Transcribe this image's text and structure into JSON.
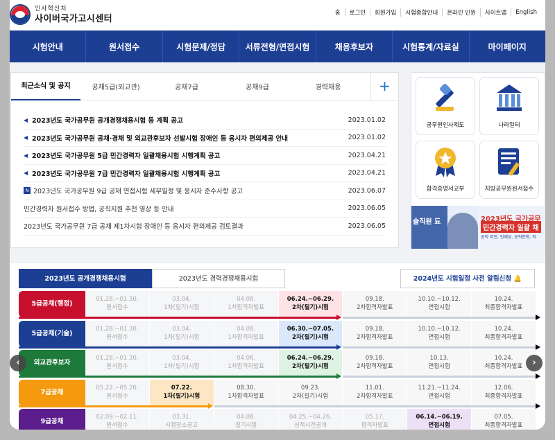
{
  "header": {
    "logo_small": "인사혁신처",
    "logo_big": "사이버국가고시센터",
    "util": [
      "홈",
      "로그인",
      "회원가입",
      "시험종합안내",
      "온라인 민원",
      "사이트맵",
      "English"
    ]
  },
  "nav": [
    "시험안내",
    "원서접수",
    "시험문제/정답",
    "서류전형/면접시험",
    "채용후보자",
    "시험통계/자료실",
    "마이페이지"
  ],
  "news": {
    "tabs": [
      "최근소식 및 공지",
      "공채5급(외교관)",
      "공채7급",
      "공채9급",
      "경력채용"
    ],
    "plus": "+",
    "items": [
      {
        "title": "2023년도 국가공무원 공개경쟁채용시험 등 계획 공고",
        "date": "2023.01.02",
        "bold": true,
        "icon": "speaker"
      },
      {
        "title": "2023년도 국가공무원 공채·경채 및 외교관후보자 선발시험 장애인 등 응시자 편의제공 안내",
        "date": "2023.01.02",
        "bold": true,
        "icon": "speaker"
      },
      {
        "title": "2023년도 국가공무원 5급 민간경력자 일괄채용시험 시행계획 공고",
        "date": "2023.04.21",
        "bold": true,
        "icon": "speaker"
      },
      {
        "title": "2023년도 국가공무원 7급 민간경력자 일괄채용시험 시행계획 공고",
        "date": "2023.04.21",
        "bold": true,
        "icon": "speaker"
      },
      {
        "title": "2023년도 국가공무원 9급 공채 면접시험 세부일정 및 응시자 준수사항 공고",
        "date": "2023.06.07",
        "bold": false,
        "icon": "new"
      },
      {
        "title": "민간경력자 원서접수 방법, 공직지원 추천 영상 등 안내",
        "date": "2023.06.05",
        "bold": false,
        "icon": ""
      },
      {
        "title": "2023년도 국가공무원 7급 공채 제1차시험 장애인 등 응시자 편의제공 검토결과",
        "date": "2023.06.05",
        "bold": false,
        "icon": ""
      }
    ]
  },
  "quick": {
    "cards": [
      "공무원인사제도",
      "나라일터",
      "합격증명서교부",
      "지방공무원원서접수"
    ],
    "banner_left": "슬직원 됴",
    "banner_t1": "2023년도 국가공무",
    "banner_t2": "민간경력자 일괄 채",
    "banner_t3": "공직 비전, 인재상, 공직문화, 직"
  },
  "schedule": {
    "tabs": [
      "2023년도 공개경쟁채용시험",
      "2023년도 경력경쟁채용시험"
    ],
    "alarm": "2024년도 시험일정 사전 알림신청",
    "rows": [
      {
        "name": "5급공채(행정)",
        "color": "#c8102e",
        "cells": [
          [
            "01.28.~01.30.",
            "원서접수"
          ],
          [
            "03.04.",
            "1차(필기)시험"
          ],
          [
            "04.06.",
            "1차합격자발표"
          ],
          [
            "06.24.~06.29.",
            "2차(필기)시험"
          ],
          [
            "09.18.",
            "2차합격자발표"
          ],
          [
            "10.10.~10.12.",
            "면접시험"
          ],
          [
            "10.24.",
            "최종합격자발표"
          ]
        ],
        "current": 3,
        "hlbg": "#fde3e6"
      },
      {
        "name": "5급공채(기술)",
        "color": "#1c3f94",
        "cells": [
          [
            "01.28.~01.30.",
            "원서접수"
          ],
          [
            "03.04.",
            "1차(필기)시험"
          ],
          [
            "04.06.",
            "1차합격자발표"
          ],
          [
            "06.30.~07.05.",
            "2차(필기)시험"
          ],
          [
            "09.18.",
            "2차합격자발표"
          ],
          [
            "10.10.~10.12.",
            "면접시험"
          ],
          [
            "10.24.",
            "최종합격자발표"
          ]
        ],
        "current": 3,
        "hlbg": "#dbe8fb"
      },
      {
        "name": "외교관후보자",
        "color": "#1d7a3a",
        "cells": [
          [
            "01.28.~01.30.",
            "원서접수"
          ],
          [
            "03.04.",
            "1차(필기)시험"
          ],
          [
            "04.06.",
            "1차합격자발표"
          ],
          [
            "06.24.~06.29.",
            "2차(필기)시험"
          ],
          [
            "09.18.",
            "2차합격자발표"
          ],
          [
            "10.13.",
            "면접시험"
          ],
          [
            "10.24.",
            "최종합격자발표"
          ]
        ],
        "current": 3,
        "hlbg": "#dff3e2"
      },
      {
        "name": "7급공채",
        "color": "#f59a0f",
        "cells": [
          [
            "05.22.~05.26.",
            "원서접수"
          ],
          [
            "07.22.",
            "1차(필기)시험"
          ],
          [
            "08.30.",
            "1차합격자발표"
          ],
          [
            "09.23.",
            "2차(필기)시험"
          ],
          [
            "11.01.",
            "2차합격자발표"
          ],
          [
            "11.21.~11.24.",
            "면접시험"
          ],
          [
            "12.06.",
            "최종합격자발표"
          ]
        ],
        "current": 1,
        "hlbg": "#fde6c4"
      },
      {
        "name": "9급공채",
        "color": "#5b1e8c",
        "cells": [
          [
            "02.09.~02.11.",
            "원서접수"
          ],
          [
            "03.31.",
            "시험장소공고"
          ],
          [
            "04.08.",
            "필기시험"
          ],
          [
            "04.25.~04.26.",
            "성적시전공개"
          ],
          [
            "05.17.",
            "합격자발표"
          ],
          [
            "06.14.~06.19.",
            "면접시험"
          ],
          [
            "07.05.",
            "최종합격자발표"
          ]
        ],
        "current": 5,
        "hlbg": "#ece0f6"
      }
    ]
  },
  "arrows": {
    "prev": "‹",
    "next": "›"
  }
}
